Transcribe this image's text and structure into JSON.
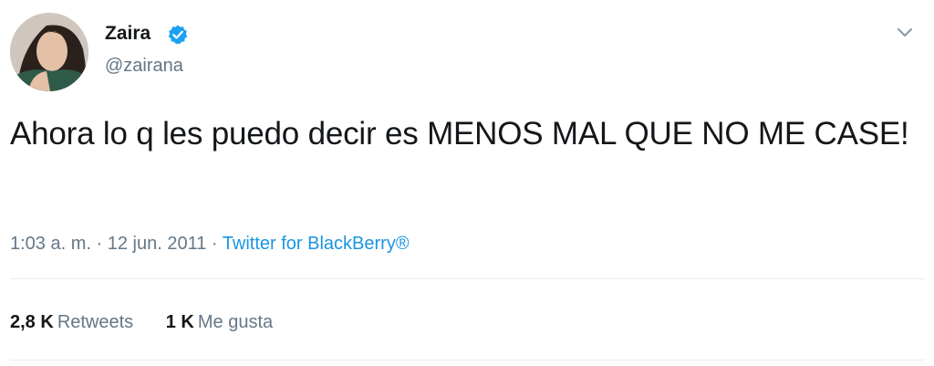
{
  "user": {
    "display_name": "Zaira",
    "username": "@zairana",
    "verified": true
  },
  "tweet": {
    "text": "Ahora lo q les puedo decir es MENOS MAL QUE NO ME CASE!",
    "time": "1:03 a. m.",
    "separator": "·",
    "date": "12 jun. 2011",
    "source": "Twitter for BlackBerry®"
  },
  "stats": {
    "retweets_count": "2,8 K",
    "retweets_label": "Retweets",
    "likes_count": "1 K",
    "likes_label": "Me gusta"
  },
  "icons": {
    "verified": "verified-badge-icon",
    "menu": "chevron-down-icon"
  },
  "colors": {
    "accent": "#1b95e0",
    "verified": "#1da1f2",
    "secondary_text": "#657786",
    "primary_text": "#14171a",
    "divider": "#e6ecf0"
  }
}
